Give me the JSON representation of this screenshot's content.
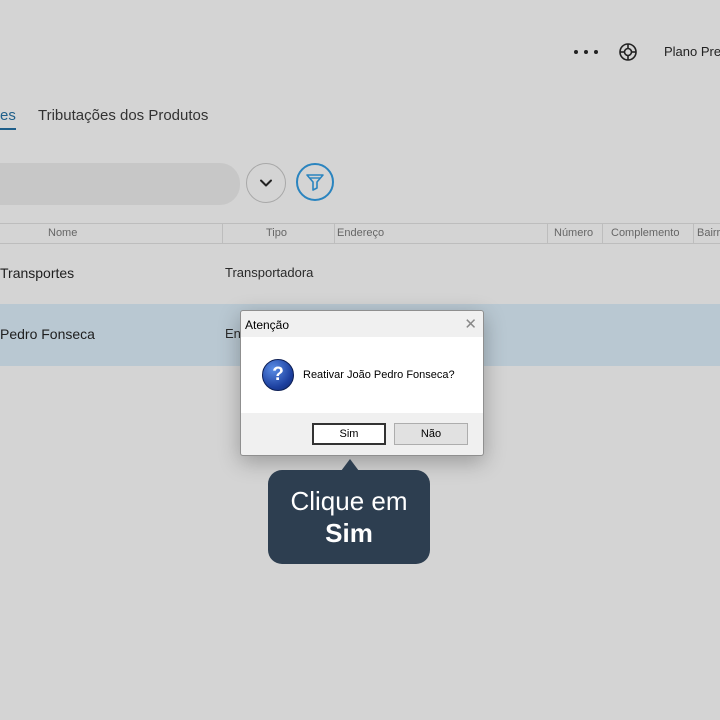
{
  "header": {
    "more_icon": "more-horizontal-icon",
    "help_icon": "lifebuoy-icon",
    "plan_label": "Plano Pre"
  },
  "tabs": [
    {
      "label": "es",
      "active": true
    },
    {
      "label": "Tributações dos Produtos",
      "active": false
    }
  ],
  "toolbar": {
    "search_value": "",
    "dropdown_icon": "chevron-down-icon",
    "filter_icon": "filter-icon"
  },
  "table": {
    "columns": [
      "Nome",
      "Tipo",
      "Endereço",
      "Número",
      "Complemento",
      "Bairr"
    ],
    "rows": [
      {
        "name": "Transportes",
        "type": "Transportadora",
        "selected": false
      },
      {
        "name": "Pedro Fonseca",
        "type": "En",
        "selected": true
      }
    ]
  },
  "dialog": {
    "title": "Atenção",
    "close_symbol": "✕",
    "icon": "question-icon",
    "icon_glyph": "?",
    "message": "Reativar João Pedro Fonseca?",
    "yes_label": "Sim",
    "no_label": "Não"
  },
  "tooltip": {
    "line1": "Clique em",
    "line2": "Sim"
  },
  "colors": {
    "background": "#d4d4d4",
    "accent": "#2a84bf",
    "selected_row": "#b9c8d2",
    "tooltip": "#2d3e50"
  }
}
